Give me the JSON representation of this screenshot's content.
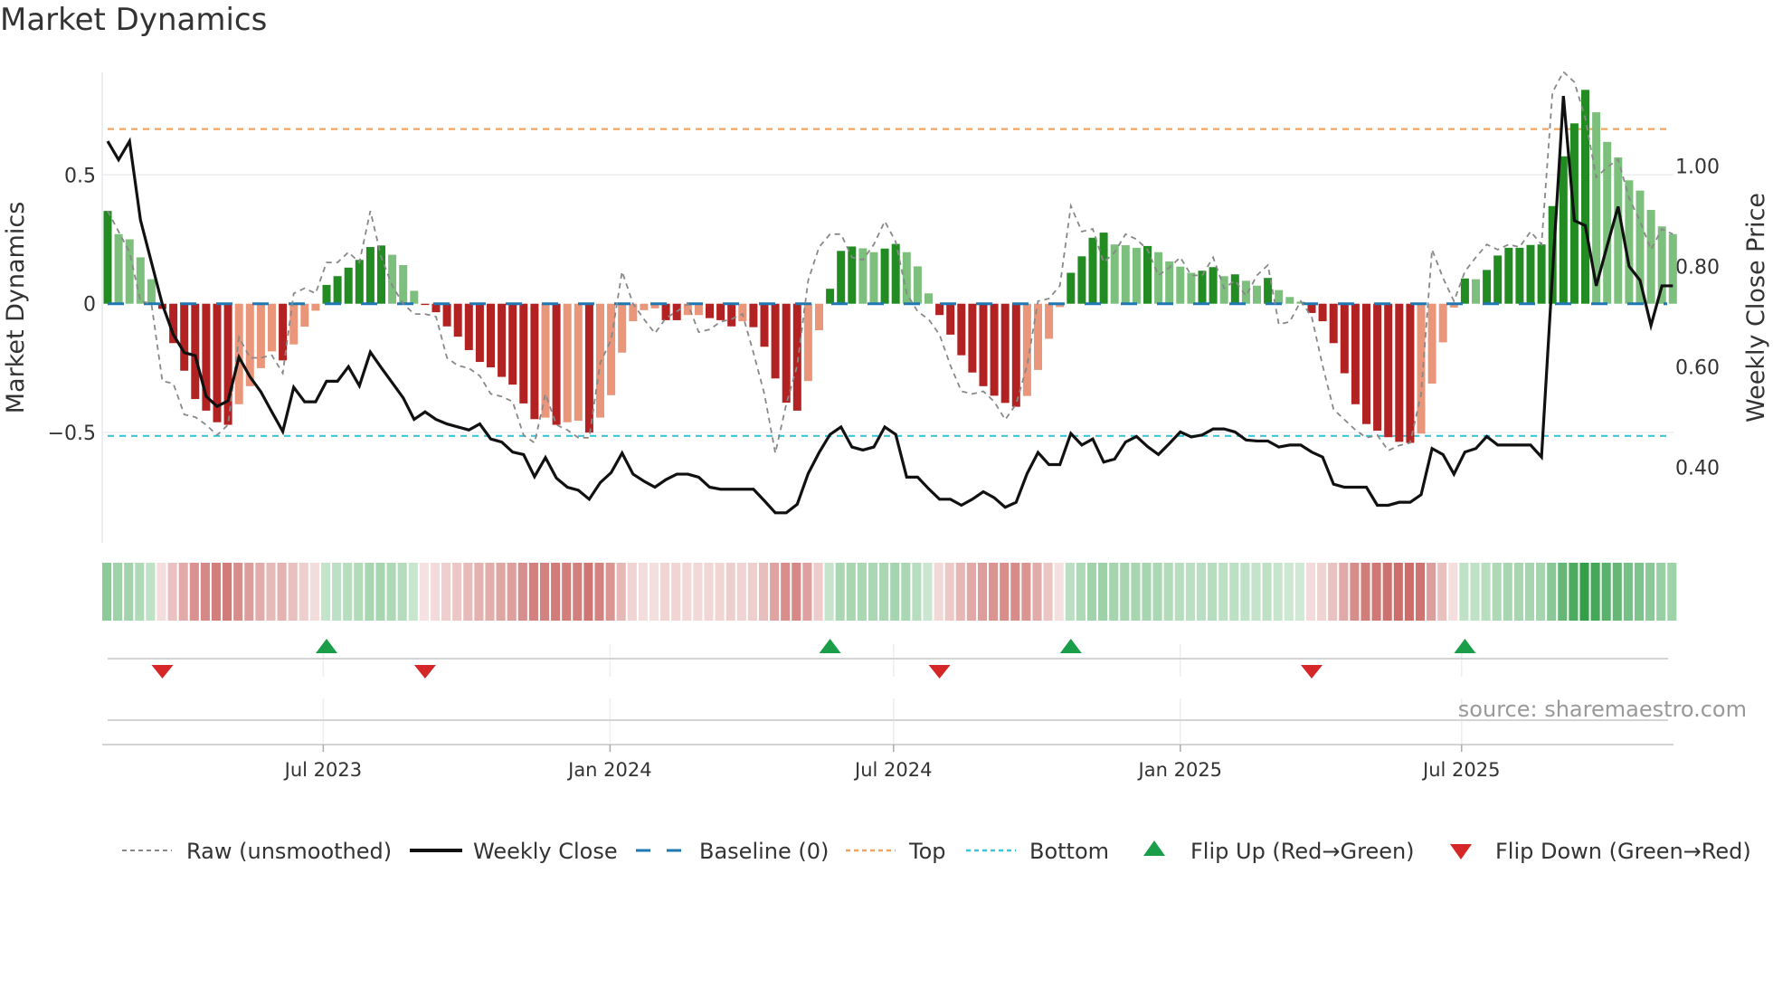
{
  "chart_data": {
    "type": "bar",
    "title": "Market Dynamics",
    "ylabel": "Market Dynamics",
    "y2label": "Weekly Close Price",
    "source": "source: sharemaestro.com",
    "ylim": [
      -0.88,
      0.95
    ],
    "y2lim": [
      0.28,
      1.19
    ],
    "yticks": [
      {
        "v": 0.5,
        "label": "0.5"
      },
      {
        "v": 0,
        "label": "0"
      },
      {
        "v": -0.5,
        "label": "−0.5"
      }
    ],
    "y2ticks": [
      {
        "v": 1.0,
        "label": "1.00"
      },
      {
        "v": 0.8,
        "label": "0.80"
      },
      {
        "v": 0.6,
        "label": "0.60"
      },
      {
        "v": 0.4,
        "label": "0.40"
      }
    ],
    "xticks": [
      {
        "week": 19.7,
        "label": "Jul 2023"
      },
      {
        "week": 45.9,
        "label": "Jan 2024"
      },
      {
        "week": 71.8,
        "label": "Jul 2024"
      },
      {
        "week": 98.0,
        "label": "Jan 2025"
      },
      {
        "week": 123.7,
        "label": "Jul 2025"
      }
    ],
    "top_level": 0.678,
    "bottom_level": -0.513,
    "baseline": 0,
    "colors": {
      "strong_green": "#228b22",
      "weak_green": "#7dbf7d",
      "strong_red": "#b22222",
      "weak_red": "#e9967a",
      "baseline": "#1f77b4",
      "top": "#f4a460",
      "bottom": "#3cc6d6",
      "flip_up": "#1a9e4a",
      "flip_down": "#d62728",
      "close": "#111111",
      "raw": "#888888"
    },
    "values": [
      0.36,
      0.27,
      0.25,
      0.18,
      0.095,
      -0.02,
      -0.153,
      -0.26,
      -0.37,
      -0.415,
      -0.46,
      -0.47,
      -0.39,
      -0.32,
      -0.25,
      -0.185,
      -0.22,
      -0.158,
      -0.089,
      -0.027,
      0.073,
      0.107,
      0.14,
      0.17,
      0.22,
      0.226,
      0.19,
      0.15,
      0.05,
      -0.005,
      -0.033,
      -0.088,
      -0.128,
      -0.18,
      -0.226,
      -0.247,
      -0.284,
      -0.314,
      -0.387,
      -0.448,
      -0.442,
      -0.47,
      -0.46,
      -0.454,
      -0.5,
      -0.442,
      -0.355,
      -0.19,
      -0.068,
      -0.025,
      -0.018,
      -0.064,
      -0.064,
      -0.044,
      -0.044,
      -0.056,
      -0.064,
      -0.088,
      -0.068,
      -0.091,
      -0.167,
      -0.29,
      -0.384,
      -0.415,
      -0.3,
      -0.103,
      0.058,
      0.205,
      0.222,
      0.215,
      0.2,
      0.214,
      0.232,
      0.2,
      0.145,
      0.04,
      -0.044,
      -0.12,
      -0.2,
      -0.267,
      -0.32,
      -0.357,
      -0.385,
      -0.4,
      -0.358,
      -0.257,
      -0.136,
      -0.013,
      0.12,
      0.184,
      0.256,
      0.276,
      0.23,
      0.227,
      0.217,
      0.224,
      0.2,
      0.164,
      0.144,
      0.12,
      0.128,
      0.142,
      0.107,
      0.114,
      0.089,
      0.07,
      0.1,
      0.053,
      0.026,
      0.008,
      -0.036,
      -0.068,
      -0.153,
      -0.27,
      -0.39,
      -0.467,
      -0.493,
      -0.518,
      -0.536,
      -0.54,
      -0.504,
      -0.31,
      -0.15,
      -0.015,
      0.098,
      0.095,
      0.131,
      0.187,
      0.217,
      0.217,
      0.228,
      0.23,
      0.379,
      0.572,
      0.7,
      0.83,
      0.743,
      0.628,
      0.568,
      0.479,
      0.439,
      0.364,
      0.3,
      0.27
    ],
    "strength": "SWWWWSSSSSSSWWWWSWWWSSSSSSWWWSSSSSSSSSSSWSWWSWWWWWWSSWWSSSWSSSSSWWSSSWWSSWWWSSSSSSSSWWWWSSSSWWWSWWWWSSWSWWSWWWSSSSSSSSSSWWWWSWSSSSSSSSSSWWWWWWWW",
    "raw": [
      0.36,
      0.28,
      0.2,
      0.01,
      0.0,
      -0.3,
      -0.31,
      -0.43,
      -0.44,
      -0.47,
      -0.51,
      -0.47,
      -0.13,
      -0.21,
      -0.21,
      -0.2,
      -0.27,
      0.04,
      0.06,
      0.04,
      0.16,
      0.16,
      0.2,
      0.16,
      0.36,
      0.18,
      0.07,
      0.0,
      -0.04,
      -0.04,
      -0.05,
      -0.21,
      -0.24,
      -0.25,
      -0.28,
      -0.35,
      -0.36,
      -0.38,
      -0.51,
      -0.54,
      -0.35,
      -0.47,
      -0.49,
      -0.52,
      -0.52,
      -0.23,
      -0.14,
      0.125,
      0.0,
      -0.06,
      -0.115,
      -0.056,
      -0.03,
      0.0,
      -0.11,
      -0.1,
      -0.07,
      -0.06,
      -0.04,
      -0.19,
      -0.35,
      -0.58,
      -0.39,
      -0.24,
      0.09,
      0.22,
      0.27,
      0.27,
      0.18,
      0.17,
      0.23,
      0.32,
      0.24,
      0.04,
      -0.03,
      -0.06,
      -0.12,
      -0.24,
      -0.34,
      -0.35,
      -0.34,
      -0.38,
      -0.45,
      -0.39,
      -0.24,
      0.01,
      0.02,
      0.07,
      0.38,
      0.28,
      0.29,
      0.16,
      0.2,
      0.27,
      0.25,
      0.21,
      0.11,
      0.14,
      0.18,
      0.11,
      0.11,
      0.18,
      0.06,
      0.09,
      0.03,
      0.11,
      0.15,
      -0.08,
      -0.07,
      0.01,
      -0.05,
      -0.24,
      -0.41,
      -0.45,
      -0.49,
      -0.52,
      -0.51,
      -0.57,
      -0.55,
      -0.54,
      -0.35,
      0.21,
      0.1,
      0.01,
      0.125,
      0.18,
      0.23,
      0.21,
      0.23,
      0.22,
      0.28,
      0.23,
      0.82,
      0.9,
      0.86,
      0.72,
      0.49,
      0.53,
      0.56,
      0.41,
      0.32,
      0.21,
      0.29,
      0.27
    ],
    "close": [
      1.049,
      1.012,
      1.049,
      0.892,
      0.808,
      0.724,
      0.664,
      0.628,
      0.622,
      0.541,
      0.521,
      0.532,
      0.619,
      0.58,
      0.55,
      0.51,
      0.471,
      0.559,
      0.53,
      0.53,
      0.571,
      0.571,
      0.6,
      0.562,
      0.629,
      0.598,
      0.568,
      0.538,
      0.495,
      0.51,
      0.495,
      0.486,
      0.48,
      0.474,
      0.486,
      0.456,
      0.45,
      0.43,
      0.425,
      0.381,
      0.419,
      0.378,
      0.36,
      0.354,
      0.336,
      0.369,
      0.389,
      0.428,
      0.386,
      0.372,
      0.36,
      0.375,
      0.386,
      0.386,
      0.38,
      0.36,
      0.356,
      0.356,
      0.356,
      0.356,
      0.333,
      0.309,
      0.309,
      0.326,
      0.387,
      0.429,
      0.465,
      0.48,
      0.44,
      0.434,
      0.44,
      0.48,
      0.465,
      0.38,
      0.38,
      0.357,
      0.336,
      0.336,
      0.324,
      0.336,
      0.351,
      0.339,
      0.32,
      0.33,
      0.387,
      0.429,
      0.405,
      0.405,
      0.467,
      0.444,
      0.456,
      0.41,
      0.416,
      0.45,
      0.461,
      0.441,
      0.425,
      0.447,
      0.47,
      0.46,
      0.464,
      0.476,
      0.476,
      0.47,
      0.454,
      0.452,
      0.452,
      0.44,
      0.444,
      0.444,
      0.43,
      0.42,
      0.366,
      0.36,
      0.36,
      0.36,
      0.324,
      0.324,
      0.33,
      0.33,
      0.345,
      0.437,
      0.425,
      0.386,
      0.43,
      0.437,
      0.461,
      0.444,
      0.444,
      0.444,
      0.444,
      0.42,
      0.784,
      1.139,
      0.891,
      0.881,
      0.761,
      0.841,
      0.919,
      0.8,
      0.772,
      0.682,
      0.761,
      0.761
    ],
    "flips_up": [
      20,
      66,
      88,
      124
    ],
    "flips_down": [
      5,
      29,
      76,
      110
    ],
    "legend": {
      "position": "bottom",
      "items": [
        {
          "key": "raw",
          "label": "Raw (unsmoothed)"
        },
        {
          "key": "close",
          "label": "Weekly Close"
        },
        {
          "key": "baseline",
          "label": "Baseline (0)"
        },
        {
          "key": "top",
          "label": "Top"
        },
        {
          "key": "bottom",
          "label": "Bottom"
        },
        {
          "key": "flip_up",
          "label": "Flip Up (Red→Green)"
        },
        {
          "key": "flip_down",
          "label": "Flip Down (Green→Red)"
        }
      ]
    }
  }
}
